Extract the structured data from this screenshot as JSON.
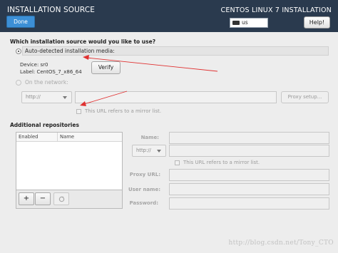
{
  "header": {
    "title": "INSTALLATION SOURCE",
    "product": "CENTOS LINUX 7 INSTALLATION",
    "done_label": "Done",
    "keyboard_layout": "us",
    "help_label": "Help!",
    "background_color": "#2a3a4e",
    "done_color": "#3c8fd6"
  },
  "source": {
    "question": "Which installation source would you like to use?",
    "auto_label": "Auto-detected installation media:",
    "device_text": "Device: sr0",
    "label_text": "Label: CentOS_7_x86_64",
    "verify_label": "Verify",
    "network_label": "On the network:",
    "protocol": "http://",
    "url_value": "",
    "proxy_label": "Proxy setup...",
    "mirror_label": "This URL refers to a mirror list."
  },
  "repos": {
    "title": "Additional repositories",
    "columns": [
      "Enabled",
      "Name"
    ],
    "rows": [],
    "add_label": "+",
    "remove_label": "−",
    "reset_icon": "reset-icon"
  },
  "repo_form": {
    "name_label": "Name:",
    "protocol": "http://",
    "mirror_label": "This URL refers to a mirror list.",
    "proxy_url_label": "Proxy URL:",
    "user_name_label": "User name:",
    "password_label": "Password:"
  },
  "annotations": {
    "arrow_color": "#e03030"
  },
  "watermark": "http://blog.csdn.net/Tony_CTO"
}
